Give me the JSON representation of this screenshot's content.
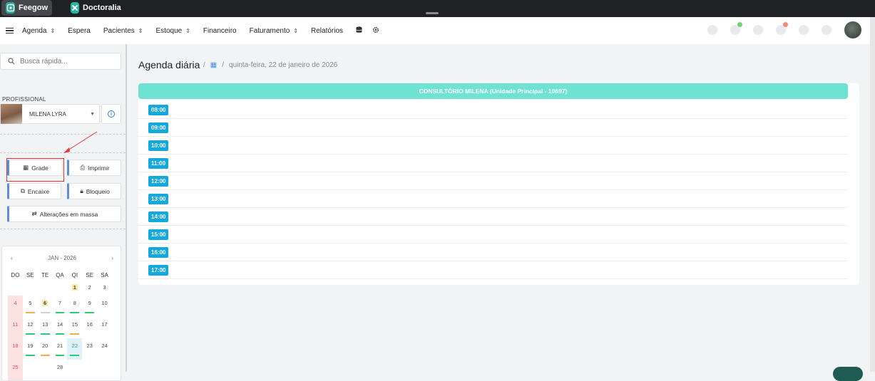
{
  "brand_tabs": [
    {
      "label": "Feegow",
      "color": "#2aa89a"
    },
    {
      "label": "Doctoralia",
      "color": "#21b8a5"
    }
  ],
  "nav": {
    "items": [
      {
        "label": "Agenda",
        "caret": true
      },
      {
        "label": "Espera",
        "caret": false
      },
      {
        "label": "Pacientes",
        "caret": true
      },
      {
        "label": "Estoque",
        "caret": true
      },
      {
        "label": "Financeiro",
        "caret": false
      },
      {
        "label": "Faturamento",
        "caret": true
      },
      {
        "label": "Relatórios",
        "caret": false
      }
    ],
    "icons": [
      "database-icon",
      "gear-icon"
    ]
  },
  "sidebar": {
    "search_placeholder": "Busca rápida...",
    "professional_label": "PROFISSIONAL",
    "professional_name": "MILENA LYRA",
    "buttons": {
      "grade": "Grade",
      "imprimir": "Imprimir",
      "encaixe": "Encaixe",
      "bloqueio": "Bloqueio",
      "alteracoes": "Alterações em massa"
    }
  },
  "calendar": {
    "month_label": "JAN - 2026",
    "weekdays": [
      "DO",
      "SE",
      "TE",
      "QA",
      "QI",
      "SE",
      "SA"
    ],
    "weeks": [
      [
        {
          "d": ""
        },
        {
          "d": ""
        },
        {
          "d": ""
        },
        {
          "d": ""
        },
        {
          "d": "1",
          "holiday": true
        },
        {
          "d": "2"
        },
        {
          "d": "3"
        }
      ],
      [
        {
          "d": "4",
          "sunday": true
        },
        {
          "d": "5",
          "bar": "#f0ad4e"
        },
        {
          "d": "6",
          "holiday": true,
          "bar": "#d0d0d0"
        },
        {
          "d": "7",
          "bar": "#2ecc71"
        },
        {
          "d": "8",
          "bar": "#2ecc71"
        },
        {
          "d": "9",
          "bar": "#2ecc71"
        },
        {
          "d": "10"
        }
      ],
      [
        {
          "d": "11",
          "sunday": true
        },
        {
          "d": "12",
          "bar": "#2ecc71"
        },
        {
          "d": "13",
          "bar": "#2ecc71"
        },
        {
          "d": "14",
          "bar": "#2ecc71"
        },
        {
          "d": "15",
          "bar": "#f0ad4e"
        },
        {
          "d": "16"
        },
        {
          "d": "17"
        }
      ],
      [
        {
          "d": "18",
          "sunday": true
        },
        {
          "d": "19",
          "bar": "#2ecc71"
        },
        {
          "d": "20",
          "bar": "#f0ad4e"
        },
        {
          "d": "21",
          "bar": "#2ecc71"
        },
        {
          "d": "22",
          "today": true,
          "bar": "#2ecc71"
        },
        {
          "d": "23"
        },
        {
          "d": "24"
        }
      ],
      [
        {
          "d": "25",
          "sunday": true
        },
        {
          "d": ""
        },
        {
          "d": ""
        },
        {
          "d": "28"
        },
        {
          "d": ""
        },
        {
          "d": ""
        },
        {
          "d": ""
        }
      ]
    ]
  },
  "main": {
    "title": "Agenda diária",
    "date": "quinta-feira, 22 de janeiro de 2026",
    "room": "CONSULTÓRIO MILENA (Unidade Principal - 10697)",
    "times": [
      "08:00",
      "09:00",
      "10:00",
      "11:00",
      "12:00",
      "13:00",
      "14:00",
      "15:00",
      "16:00",
      "17:00"
    ]
  }
}
